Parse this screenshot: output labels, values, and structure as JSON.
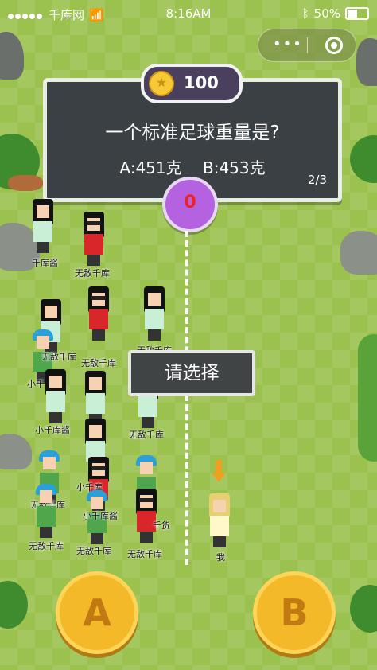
{
  "status_bar": {
    "carrier": "千库网",
    "time": "8:16AM",
    "battery": "50%"
  },
  "icons": {
    "signal": "signal-dots-icon",
    "wifi": "wifi-icon",
    "bluetooth": "bluetooth-icon",
    "battery": "battery-icon",
    "more": "more-dots-icon",
    "target": "target-icon",
    "coin": "coin-icon",
    "arrow": "arrow-down-icon"
  },
  "coins": "100",
  "question": {
    "text": "一个标准足球重量是?",
    "option_a": "A:451克",
    "option_b": "B:453克",
    "progress": "2/3"
  },
  "timer": "0",
  "prompt": "请选择",
  "players": [
    {
      "label": "千库酱"
    },
    {
      "label": "无敌千库"
    },
    {
      "label": "无敌千库"
    },
    {
      "label": "无敌千库"
    },
    {
      "label": "小千"
    },
    {
      "label": "无敌千库"
    },
    {
      "label": "小千库酱"
    },
    {
      "label": "无敌千库"
    },
    {
      "label": "小千库"
    },
    {
      "label": "小千库酱"
    },
    {
      "label": "无敌千库"
    },
    {
      "label": "无敌千库"
    },
    {
      "label": "千货"
    },
    {
      "label": "无敌千库"
    },
    {
      "label": "我"
    }
  ],
  "buttons": {
    "a": "A",
    "b": "B"
  },
  "colors": {
    "grass": "#9bc14e",
    "board": "#3a4044",
    "coin": "#f7c934",
    "timer": "#b562e0",
    "button": "#f3b928"
  }
}
